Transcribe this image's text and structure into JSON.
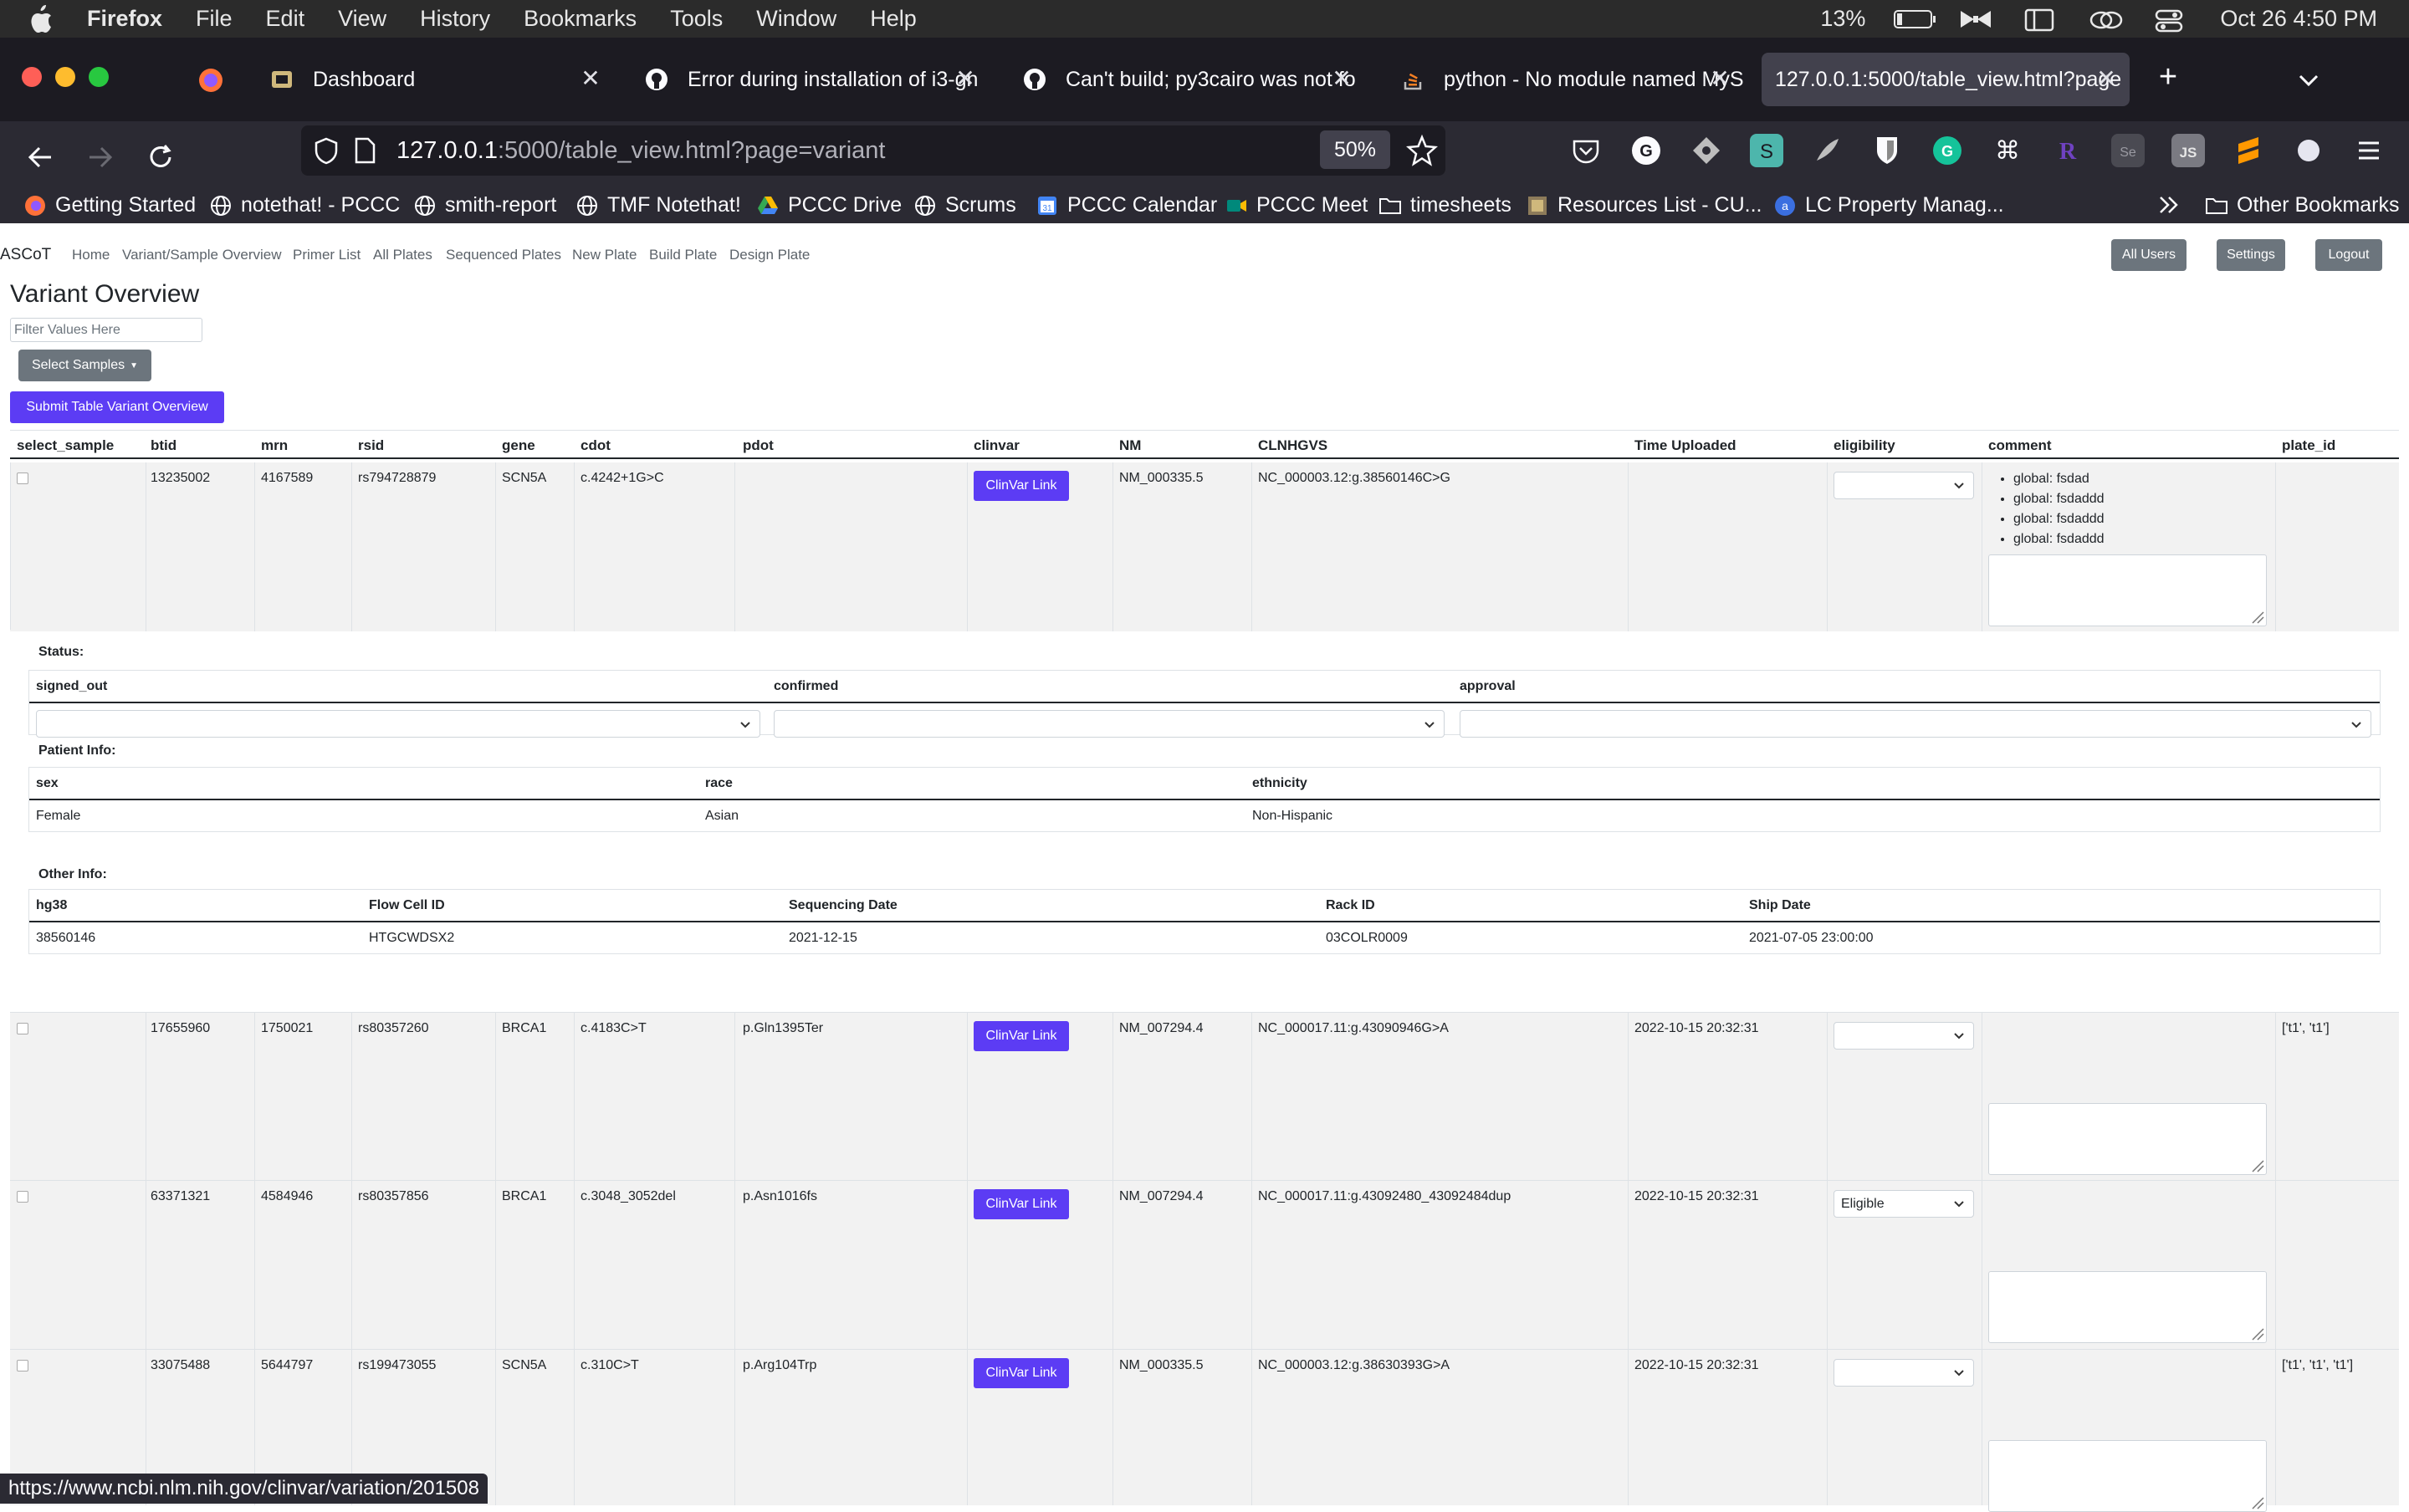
{
  "menubar": {
    "app": "Firefox",
    "items": [
      "File",
      "Edit",
      "View",
      "History",
      "Bookmarks",
      "Tools",
      "Window",
      "Help"
    ],
    "battery": "13%",
    "datetime": "Oct 26  4:50 PM"
  },
  "tabs": [
    {
      "label": "Dashboard",
      "icon": "dashboard-icon"
    },
    {
      "label": "Error during installation of i3-gn",
      "icon": "github-icon"
    },
    {
      "label": "Can't build; py3cairo was not fo",
      "icon": "github-icon"
    },
    {
      "label": "python - No module named MyS",
      "icon": "stackoverflow-icon"
    },
    {
      "label": "127.0.0.1:5000/table_view.html?page",
      "icon": "none"
    }
  ],
  "url": {
    "host": "127.0.0.1",
    "path": ":5000/table_view.html?page=variant"
  },
  "zoom": "50%",
  "bookmarks": [
    "Getting Started",
    "notethat! - PCCC",
    "smith-report",
    "TMF Notethat!",
    "PCCC Drive",
    "Scrums",
    "PCCC Calendar",
    "PCCC Meet",
    "timesheets",
    "Resources List - CU...",
    "LC Property Manag...",
    "Other Bookmarks"
  ],
  "appnav": {
    "brand": "ASCoT",
    "links": [
      "Home",
      "Variant/Sample Overview",
      "Primer List",
      "All Plates",
      "Sequenced Plates",
      "New Plate",
      "Build Plate",
      "Design Plate"
    ],
    "buttons": [
      "All Users",
      "Settings",
      "Logout"
    ]
  },
  "page": {
    "title": "Variant Overview",
    "filter_placeholder": "Filter Values Here",
    "select_samples": "Select Samples",
    "submit": "Submit Table Variant Overview"
  },
  "table": {
    "headers": [
      "select_sample",
      "btid",
      "mrn",
      "rsid",
      "gene",
      "cdot",
      "pdot",
      "clinvar",
      "NM",
      "CLNHGVS",
      "Time Uploaded",
      "eligibility",
      "comment",
      "plate_id"
    ],
    "clinvar_label": "ClinVar Link",
    "rows": [
      {
        "btid": "13235002",
        "mrn": "4167589",
        "rsid": "rs794728879",
        "gene": "SCN5A",
        "cdot": "c.4242+1G>C",
        "pdot": "",
        "nm": "NM_000335.5",
        "clnhgvs": "NC_000003.12:g.38560146C>G",
        "time": "",
        "eligibility": "",
        "comments": [
          "global: fsdad",
          "global: fsdaddd",
          "global: fsdaddd",
          "global: fsdaddd"
        ],
        "plate_id": ""
      },
      {
        "btid": "17655960",
        "mrn": "1750021",
        "rsid": "rs80357260",
        "gene": "BRCA1",
        "cdot": "c.4183C>T",
        "pdot": "p.Gln1395Ter",
        "nm": "NM_007294.4",
        "clnhgvs": "NC_000017.11:g.43090946G>A",
        "time": "2022-10-15 20:32:31",
        "eligibility": "",
        "comments": [],
        "plate_id": "['t1', 't1']"
      },
      {
        "btid": "63371321",
        "mrn": "4584946",
        "rsid": "rs80357856",
        "gene": "BRCA1",
        "cdot": "c.3048_3052del",
        "pdot": "p.Asn1016fs",
        "nm": "NM_007294.4",
        "clnhgvs": "NC_000017.11:g.43092480_43092484dup",
        "time": "2022-10-15 20:32:31",
        "eligibility": "Eligible",
        "comments": [],
        "plate_id": ""
      },
      {
        "btid": "33075488",
        "mrn": "5644797",
        "rsid": "rs199473055",
        "gene": "SCN5A",
        "cdot": "c.310C>T",
        "pdot": "p.Arg104Trp",
        "nm": "NM_000335.5",
        "clnhgvs": "NC_000003.12:g.38630393G>A",
        "time": "2022-10-15 20:32:31",
        "eligibility": "",
        "comments": [],
        "plate_id": "['t1', 't1', 't1']"
      }
    ]
  },
  "details": {
    "status_label": "Status:",
    "status_headers": [
      "signed_out",
      "confirmed",
      "approval"
    ],
    "patient_label": "Patient Info:",
    "patient_headers": [
      "sex",
      "race",
      "ethnicity"
    ],
    "patient_values": [
      "Female",
      "Asian",
      "Non-Hispanic"
    ],
    "other_label": "Other Info:",
    "other_headers": [
      "hg38",
      "Flow Cell ID",
      "Sequencing Date",
      "Rack ID",
      "Ship Date"
    ],
    "other_values": [
      "38560146",
      "HTGCWDSX2",
      "2021-12-15",
      "03COLR0009",
      "2021-07-05 23:00:00"
    ]
  },
  "statusbar": "https://www.ncbi.nlm.nih.gov/clinvar/variation/201508",
  "colors": {
    "primary": "#5c3cf4",
    "secondary": "#6c757d",
    "row_bg": "#f2f2f2"
  }
}
